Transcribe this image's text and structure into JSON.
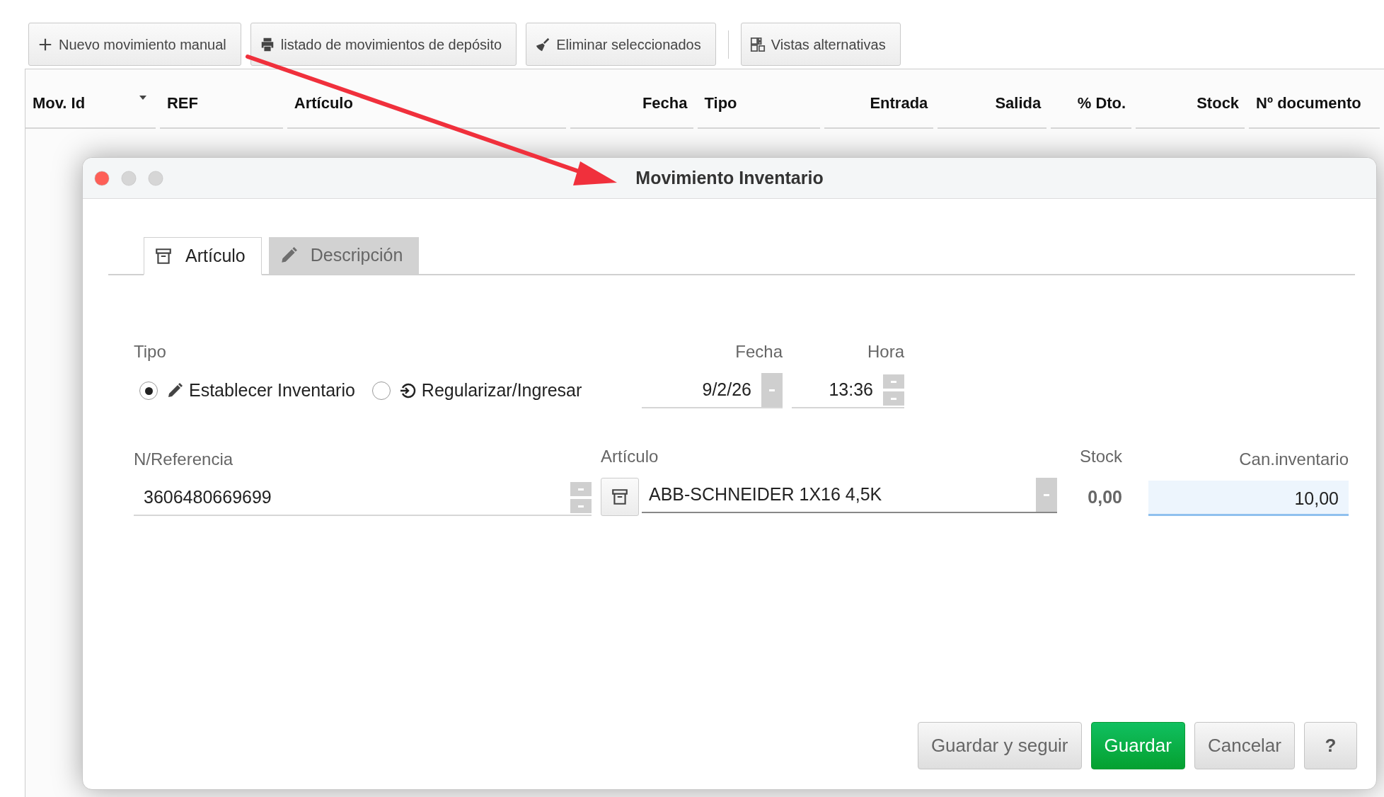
{
  "toolbar": {
    "buttons": [
      {
        "label": "Nuevo movimiento manual",
        "kind": "plus"
      },
      {
        "label": "listado de movimientos de depósito",
        "kind": "print"
      },
      {
        "label": "Eliminar seleccionados",
        "kind": "broom"
      },
      {
        "label": "Vistas alternativas",
        "kind": "views"
      }
    ]
  },
  "table": {
    "columns": [
      {
        "label": "Mov. Id",
        "sorted": true
      },
      {
        "label": "REF",
        "sorted": false
      },
      {
        "label": "Artículo",
        "sorted": false
      },
      {
        "label": "Fecha",
        "sorted": false
      },
      {
        "label": "Tipo",
        "sorted": false
      },
      {
        "label": "Entrada",
        "sorted": false
      },
      {
        "label": "Salida",
        "sorted": false
      },
      {
        "label": "% Dto.",
        "sorted": false
      },
      {
        "label": "Stock",
        "sorted": false
      },
      {
        "label": "Nº documento",
        "sorted": false
      }
    ]
  },
  "dialog": {
    "title": "Movimiento Inventario",
    "tabs": [
      {
        "label": "Artículo",
        "selected": true,
        "kind": "box"
      },
      {
        "label": "Descripción",
        "selected": false,
        "kind": "pencil"
      }
    ],
    "tipo": {
      "label": "Tipo",
      "options": [
        {
          "label": "Establecer Inventario",
          "selected": true,
          "kind": "pencil"
        },
        {
          "label": "Regularizar/Ingresar",
          "selected": false,
          "kind": "enter"
        }
      ]
    },
    "fecha": {
      "label": "Fecha",
      "value": "9/2/26"
    },
    "hora": {
      "label": "Hora",
      "value": "13:36"
    },
    "referencia": {
      "label": "N/Referencia",
      "value": "3606480669699"
    },
    "articulo": {
      "label": "Artículo",
      "value": "ABB-SCHNEIDER 1X16 4,5K"
    },
    "stock": {
      "label": "Stock",
      "value": "0,00"
    },
    "cantidad": {
      "label": "Can.inventario",
      "value": "10,00",
      "focused": true
    },
    "buttons": [
      {
        "label": "Guardar y seguir",
        "kind": "plain"
      },
      {
        "label": "Guardar",
        "kind": "primary"
      },
      {
        "label": "Cancelar",
        "kind": "plain"
      },
      {
        "label": "?",
        "kind": "help"
      }
    ]
  }
}
